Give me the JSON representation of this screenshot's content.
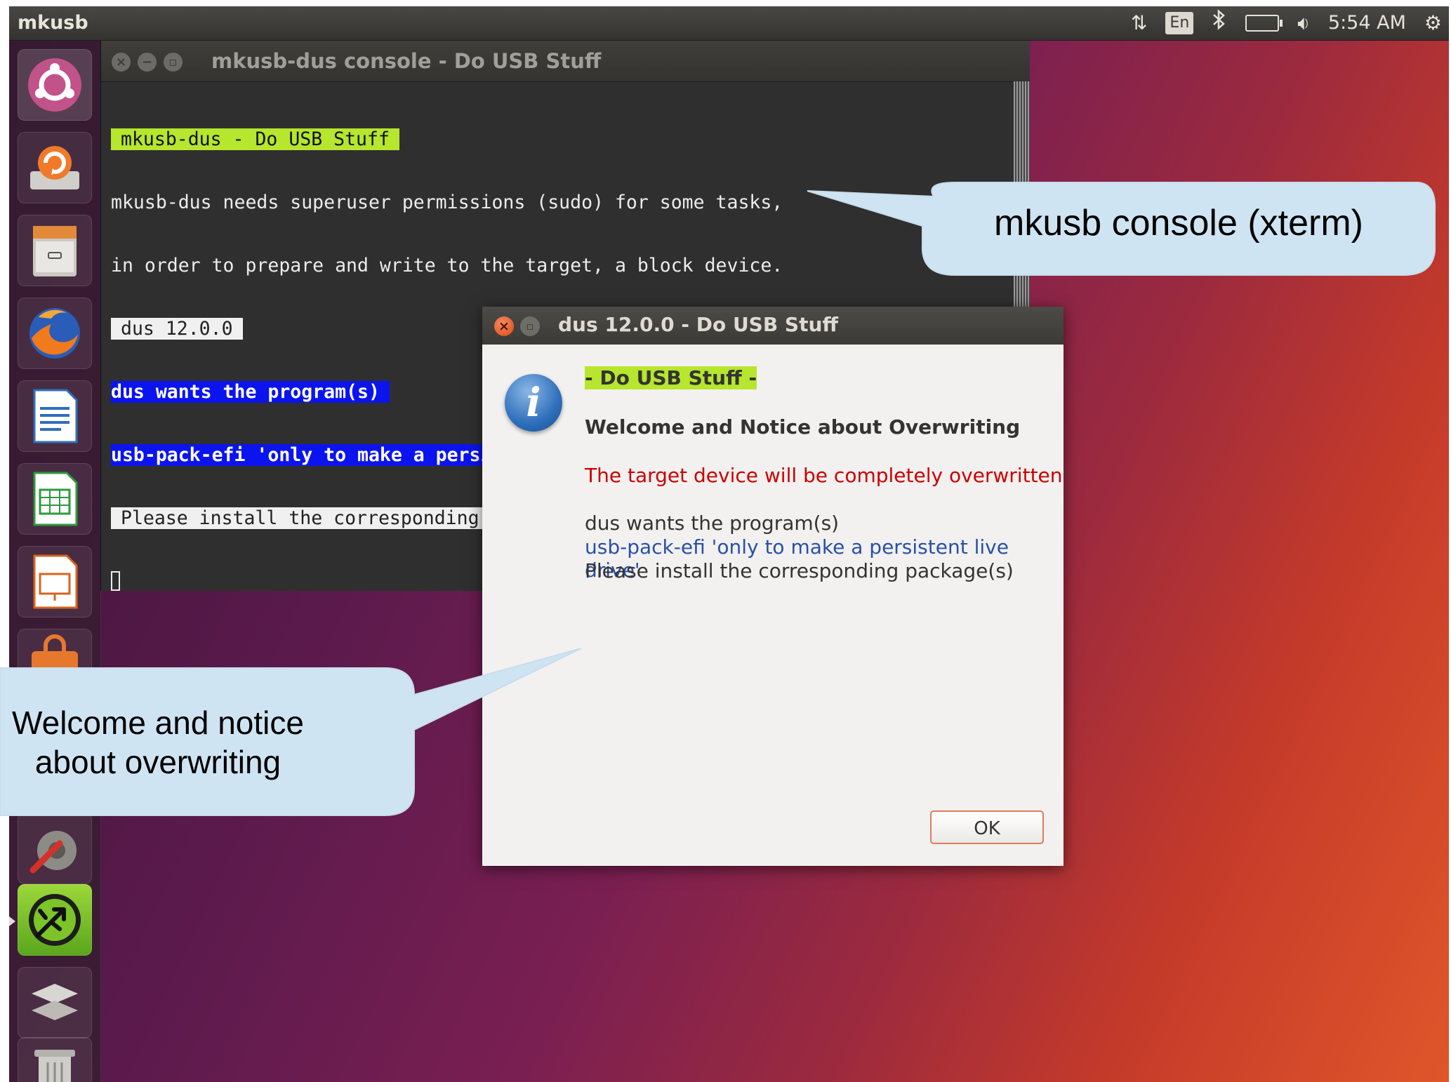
{
  "top_panel": {
    "app_name": "mkusb",
    "keyboard_layout": "En",
    "clock": "5:54 AM",
    "icons": [
      "network-arrows-icon",
      "bluetooth-icon",
      "battery-icon",
      "volume-icon",
      "power-icon"
    ]
  },
  "launcher": {
    "items": [
      {
        "name": "ubuntu-dash-icon"
      },
      {
        "name": "software-updater-icon"
      },
      {
        "name": "files-icon"
      },
      {
        "name": "firefox-icon"
      },
      {
        "name": "libreoffice-writer-icon"
      },
      {
        "name": "libreoffice-calc-icon"
      },
      {
        "name": "libreoffice-impress-icon"
      },
      {
        "name": "ubuntu-software-icon"
      },
      {
        "name": "system-settings-icon"
      },
      {
        "name": "mkusb-icon"
      },
      {
        "name": "workspace-switcher-icon"
      },
      {
        "name": "trash-icon"
      }
    ]
  },
  "terminal": {
    "title": "mkusb-dus console - Do USB Stuff",
    "lines": [
      "mkusb-dus - Do USB Stuff",
      "mkusb-dus needs superuser permissions (sudo) for some tasks,",
      "in order to prepare and write to the target, a block device.",
      "dus 12.0.0",
      "dus wants the program(s)",
      "usb-pack-efi 'only to make a persistent live drive'",
      "Please install the corresponding package(s)"
    ]
  },
  "dialog": {
    "title": "dus 12.0.0 - Do USB Stuff",
    "heading": "- Do USB Stuff -",
    "subheading": "Welcome and Notice about Overwriting",
    "warning": "The target device will be completely overwritten",
    "line1": "dus wants the program(s)",
    "line2": "usb-pack-efi 'only to make a persistent live drive'",
    "line3": "Please install the corresponding package(s)",
    "ok_label": "OK"
  },
  "callouts": {
    "console": "mkusb console (xterm)",
    "welcome_line1": "Welcome and notice",
    "welcome_line2": "about overwriting"
  },
  "colors": {
    "highlight_green": "#b6e62d",
    "highlight_blue": "#0b14ef",
    "warning_red": "#cc0000",
    "link_blue": "#2a4fa8",
    "callout_fill": "#cfe4f3",
    "close_orange": "#dd4814"
  }
}
